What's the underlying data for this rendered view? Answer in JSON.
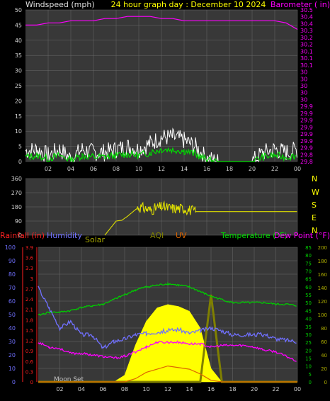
{
  "header": {
    "left": "Windspeed (mph)",
    "center": "24 hour graph day : December 10 2024",
    "right": "Barometer ( in)"
  },
  "colors": {
    "background": "#000000",
    "plot_bg": "#383838",
    "grid": "#6a6a6a",
    "axis_text": "#d0d0d0",
    "title_yellow": "#ffff00",
    "barometer": "#ff00ff",
    "gust": "#ffffff",
    "wind": "#00dd00",
    "direction": "#dddd00",
    "rain": "#ff2020",
    "humidity": "#7070ff",
    "solar": "#aaaa00",
    "aqi": "#808000",
    "uv": "#dd6600",
    "temperature": "#00cc00",
    "dewpoint": "#ff00ff"
  },
  "x_tick_labels": [
    "02",
    "04",
    "06",
    "08",
    "10",
    "12",
    "14",
    "16",
    "18",
    "20",
    "22",
    "00"
  ],
  "panel2_compass": [
    "N",
    "W",
    "S",
    "E",
    "N"
  ],
  "panel3_legend": {
    "rainfall": "Rainfall (in)",
    "humidity": "Humidity",
    "solar": "Solar",
    "aqi": "AQI",
    "uv": "UV",
    "temperature": "Temperature (°F)",
    "dewpoint": "Dew Point (°F)"
  },
  "moonset_label": "Moon Set",
  "chart_data": [
    {
      "type": "line",
      "title": "24 hour graph day : December 10 2024",
      "ylabel": "Windspeed (mph)",
      "y2label": "Barometer ( in)",
      "ylim": [
        0,
        50
      ],
      "y_ticks": [
        0,
        5,
        10,
        15,
        20,
        25,
        30,
        35,
        40,
        45,
        50
      ],
      "y2lim": [
        29.8,
        30.5
      ],
      "y2_ticks": [
        "29.8",
        "29.8",
        "29.9",
        "29.9",
        "29.9",
        "29.9",
        "29.9",
        "29.9",
        "29.9",
        "30",
        "30",
        "30",
        "30",
        "30",
        "30.1",
        "30.1",
        "30.1",
        "30.2",
        "30.2",
        "30.3",
        "30.4",
        "30.4",
        "30.5"
      ],
      "x_hours": [
        0,
        1,
        2,
        3,
        4,
        5,
        6,
        7,
        8,
        9,
        10,
        11,
        12,
        13,
        14,
        15,
        16,
        17,
        18,
        19,
        20,
        21,
        22,
        23,
        24
      ],
      "series": [
        {
          "name": "Barometer",
          "y_axis": "right",
          "values": [
            30.43,
            30.43,
            30.44,
            30.44,
            30.45,
            30.45,
            30.45,
            30.46,
            30.46,
            30.47,
            30.47,
            30.47,
            30.46,
            30.46,
            30.45,
            30.45,
            30.45,
            30.45,
            30.45,
            30.45,
            30.45,
            30.45,
            30.45,
            30.44,
            30.41
          ]
        },
        {
          "name": "Wind Gust",
          "y_axis": "left",
          "values": [
            3.5,
            4,
            2,
            4,
            1,
            4,
            3,
            3,
            4,
            5,
            4,
            6,
            8,
            8,
            7,
            5,
            1,
            0,
            0,
            0,
            0,
            3,
            4,
            3,
            4
          ]
        },
        {
          "name": "Wind Speed",
          "y_axis": "left",
          "values": [
            1.5,
            2,
            1,
            2,
            0.5,
            2,
            1.5,
            1.5,
            2,
            2.5,
            2,
            3,
            4,
            4,
            3.5,
            2.5,
            0.5,
            0,
            0,
            0,
            0,
            1.5,
            2,
            1.5,
            2
          ]
        }
      ]
    },
    {
      "type": "line",
      "ylabel": "Wind Direction",
      "ylim": [
        0,
        360
      ],
      "y_ticks": [
        0,
        90,
        180,
        270,
        360
      ],
      "x_hours": [
        0,
        1,
        2,
        3,
        4,
        5,
        6,
        7,
        8,
        8.5,
        9,
        10,
        11,
        12,
        13,
        14,
        15,
        16,
        17,
        18,
        19,
        20,
        21,
        22,
        23,
        24
      ],
      "series": [
        {
          "name": "Direction",
          "values": [
            null,
            null,
            null,
            null,
            null,
            null,
            null,
            0,
            90,
            95,
            120,
            180,
            160,
            180,
            170,
            170,
            150,
            150,
            150,
            150,
            150,
            150,
            150,
            150,
            150,
            150
          ]
        }
      ]
    },
    {
      "type": "line",
      "ylim_humidity": [
        0,
        100
      ],
      "ylim_rain": [
        0,
        3.9
      ],
      "rain_ticks": [
        "0",
        "0.3",
        "0.6",
        "0.9",
        "1.2",
        "1.5",
        "1.8",
        "2.1",
        "2.4",
        "2.7",
        "3",
        "3.3",
        "3.6",
        "3.9"
      ],
      "ylim_temp": [
        0,
        85
      ],
      "ylim_solar": [
        0,
        200
      ],
      "x_hours": [
        0,
        1,
        2,
        3,
        4,
        5,
        6,
        7,
        8,
        9,
        10,
        11,
        12,
        13,
        14,
        15,
        16,
        17,
        18,
        19,
        20,
        21,
        22,
        23,
        24
      ],
      "series": [
        {
          "name": "Humidity",
          "y_axis": "humidity",
          "values": [
            70,
            55,
            40,
            45,
            35,
            35,
            25,
            30,
            32,
            35,
            36,
            37,
            38,
            39,
            36,
            38,
            40,
            38,
            35,
            35,
            35,
            35,
            32,
            31,
            30
          ]
        },
        {
          "name": "Temperature",
          "y_axis": "temp",
          "values": [
            42,
            44,
            44,
            45,
            47,
            48,
            49,
            52,
            55,
            58,
            60,
            61,
            62,
            61,
            60,
            57,
            54,
            52,
            50,
            50,
            50,
            50,
            49,
            49,
            48
          ]
        },
        {
          "name": "Dew Point",
          "y_axis": "temp",
          "values": [
            25,
            22,
            21,
            18,
            18,
            17,
            16,
            15,
            16,
            19,
            22,
            25,
            25,
            25,
            24,
            24,
            22,
            23,
            23,
            23,
            22,
            20,
            19,
            16,
            13
          ]
        },
        {
          "name": "Solar",
          "y_axis": "solar",
          "values": [
            0,
            0,
            0,
            0,
            0,
            0,
            0,
            0,
            10,
            55,
            90,
            110,
            115,
            112,
            105,
            80,
            20,
            0,
            0,
            0,
            0,
            0,
            0,
            0,
            0
          ]
        },
        {
          "name": "UV",
          "y_axis": "temp",
          "values": [
            0,
            0,
            0,
            0,
            0,
            0,
            0,
            0,
            0,
            2,
            6,
            8,
            10,
            9,
            8,
            5,
            1,
            0,
            0,
            0,
            0,
            0,
            0,
            0,
            0
          ]
        },
        {
          "name": "AQI",
          "y_axis": "temp",
          "values": [
            0,
            0,
            0,
            0,
            0,
            0,
            0,
            0,
            0,
            0,
            0,
            0,
            0,
            0,
            0,
            0,
            55,
            0,
            0,
            0,
            0,
            0,
            0,
            0,
            0
          ]
        }
      ]
    }
  ]
}
